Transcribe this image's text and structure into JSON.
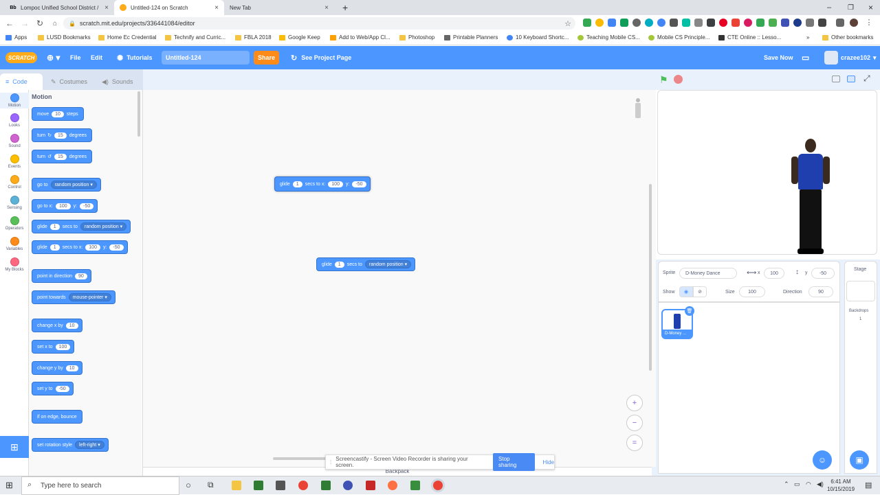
{
  "browser": {
    "tabs": [
      {
        "label": "Lompoc Unified School District /",
        "favicon": "Bb",
        "active": false
      },
      {
        "label": "Untitled-124 on Scratch",
        "favicon": "scratch",
        "active": true
      },
      {
        "label": "New Tab",
        "favicon": "",
        "active": false
      }
    ],
    "new_tab": "+",
    "url": "scratch.mit.edu/projects/336441084/editor",
    "bookmarks": [
      "Apps",
      "LUSD Bookmarks",
      "Home Ec Credential",
      "Technify and Curric...",
      "FBLA 2018",
      "Google Keep",
      "Add to Web/App Cl...",
      "Photoshop",
      "Printable Planners",
      "10 Keyboard Shortc...",
      "Teaching Mobile CS...",
      "Mobile CS Principle...",
      "CTE Online :: Lesso..."
    ],
    "more_bookmarks": "»",
    "other_bookmarks": "Other bookmarks"
  },
  "menu": {
    "logo": "SCRATCH",
    "file": "File",
    "edit": "Edit",
    "tutorials": "Tutorials",
    "project_title": "Untitled-124",
    "share": "Share",
    "see_project": "See Project Page",
    "save_now": "Save Now",
    "username": "crazee102"
  },
  "editor_tabs": {
    "code": "Code",
    "costumes": "Costumes",
    "sounds": "Sounds"
  },
  "categories": [
    {
      "label": "Motion",
      "color": "#4c97ff"
    },
    {
      "label": "Looks",
      "color": "#9966ff"
    },
    {
      "label": "Sound",
      "color": "#cf63cf"
    },
    {
      "label": "Events",
      "color": "#ffbf00"
    },
    {
      "label": "Control",
      "color": "#ffab19"
    },
    {
      "label": "Sensing",
      "color": "#5cb1d6"
    },
    {
      "label": "Operators",
      "color": "#59c059"
    },
    {
      "label": "Variables",
      "color": "#ff8c1a"
    },
    {
      "label": "My Blocks",
      "color": "#ff6680"
    }
  ],
  "palette": {
    "heading": "Motion",
    "move": {
      "a": "move",
      "n": "10",
      "b": "steps"
    },
    "turn_right": {
      "a": "turn",
      "n": "15",
      "b": "degrees"
    },
    "turn_left": {
      "a": "turn",
      "n": "15",
      "b": "degrees"
    },
    "goto": {
      "a": "go to",
      "dd": "random position"
    },
    "goto_xy": {
      "a": "go to x:",
      "x": "100",
      "b": "y:",
      "y": "-50"
    },
    "glide_random": {
      "a": "glide",
      "n": "1",
      "b": "secs to",
      "dd": "random position"
    },
    "glide_xy": {
      "a": "glide",
      "n": "1",
      "b": "secs to x:",
      "x": "100",
      "c": "y:",
      "y": "-50"
    },
    "point_dir": {
      "a": "point in direction",
      "n": "90"
    },
    "point_towards": {
      "a": "point towards",
      "dd": "mouse-pointer"
    },
    "change_x": {
      "a": "change x by",
      "n": "10"
    },
    "set_x": {
      "a": "set x to",
      "n": "100"
    },
    "change_y": {
      "a": "change y by",
      "n": "10"
    },
    "set_y": {
      "a": "set y to",
      "n": "-50"
    },
    "bounce": {
      "a": "if on edge, bounce"
    },
    "rotation": {
      "a": "set rotation style",
      "dd": "left-right"
    }
  },
  "workspace": {
    "block1": {
      "a": "glide",
      "n": "1",
      "b": "secs to x:",
      "x": "100",
      "c": "y:",
      "y": "-50"
    },
    "block2": {
      "a": "glide",
      "n": "1",
      "b": "secs to",
      "dd": "random position"
    },
    "zoom_in": "+",
    "zoom_out": "−",
    "zoom_reset": "=",
    "backpack": "Backpack"
  },
  "sprite": {
    "label": "Sprite",
    "name": "D-Money Dance",
    "x_label": "x",
    "x": "100",
    "y_label": "y",
    "y": "-50",
    "show_label": "Show",
    "size_label": "Size",
    "size": "100",
    "direction_label": "Direction",
    "direction": "90",
    "thumb_name": "D-Money ..."
  },
  "stage_panel": {
    "title": "Stage",
    "backdrops_label": "Backdrops",
    "backdrops_count": "1"
  },
  "screencastify": {
    "message": "Screencastify - Screen Video Recorder is sharing your screen.",
    "stop": "Stop sharing",
    "hide": "Hide"
  },
  "taskbar": {
    "search": "Type here to search",
    "time": "6:41 AM",
    "date": "10/15/2019"
  }
}
